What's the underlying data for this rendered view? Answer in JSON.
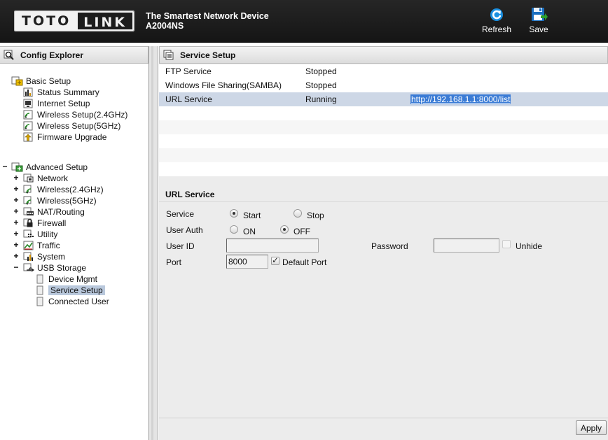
{
  "header": {
    "logo_left": "TOTO",
    "logo_right": "LINK",
    "tagline": "The Smartest Network Device",
    "model": "A2004NS",
    "refresh_label": "Refresh",
    "save_label": "Save"
  },
  "explorer": {
    "title": "Config Explorer",
    "basic": {
      "label": "Basic Setup",
      "items": [
        "Status Summary",
        "Internet Setup",
        "Wireless Setup(2.4GHz)",
        "Wireless Setup(5GHz)",
        "Firmware Upgrade"
      ]
    },
    "advanced": {
      "label": "Advanced Setup",
      "items": [
        "Network",
        "Wireless(2.4GHz)",
        "Wireless(5GHz)",
        "NAT/Routing",
        "Firewall",
        "Utility",
        "Traffic",
        "System",
        "USB Storage"
      ],
      "usb_children": [
        "Device Mgmt",
        "Service Setup",
        "Connected User"
      ]
    },
    "toggle_expanded": "−",
    "toggle_collapsed": "+"
  },
  "panel": {
    "title": "Service Setup",
    "services": [
      {
        "name": "FTP Service",
        "status": "Stopped",
        "link": ""
      },
      {
        "name": "Windows File Sharing(SAMBA)",
        "status": "Stopped",
        "link": ""
      },
      {
        "name": "URL Service",
        "status": "Running",
        "link": "http://192.168.1.1:8000/list"
      }
    ],
    "section_title": "URL Service",
    "form": {
      "service_label": "Service",
      "start_label": "Start",
      "stop_label": "Stop",
      "userauth_label": "User Auth",
      "on_label": "ON",
      "off_label": "OFF",
      "userid_label": "User ID",
      "userid_value": "",
      "password_label": "Password",
      "password_value": "",
      "unhide_label": "Unhide",
      "port_label": "Port",
      "port_value": "8000",
      "default_port_label": "Default Port"
    },
    "apply_label": "Apply"
  },
  "colors": {
    "header_bg": "#1c1c1c",
    "selected_row": "#cdd7e6",
    "selected_tree": "#b9c8dc",
    "link_highlight": "#3a7bd5",
    "refresh_icon": "#1a8fe0"
  }
}
